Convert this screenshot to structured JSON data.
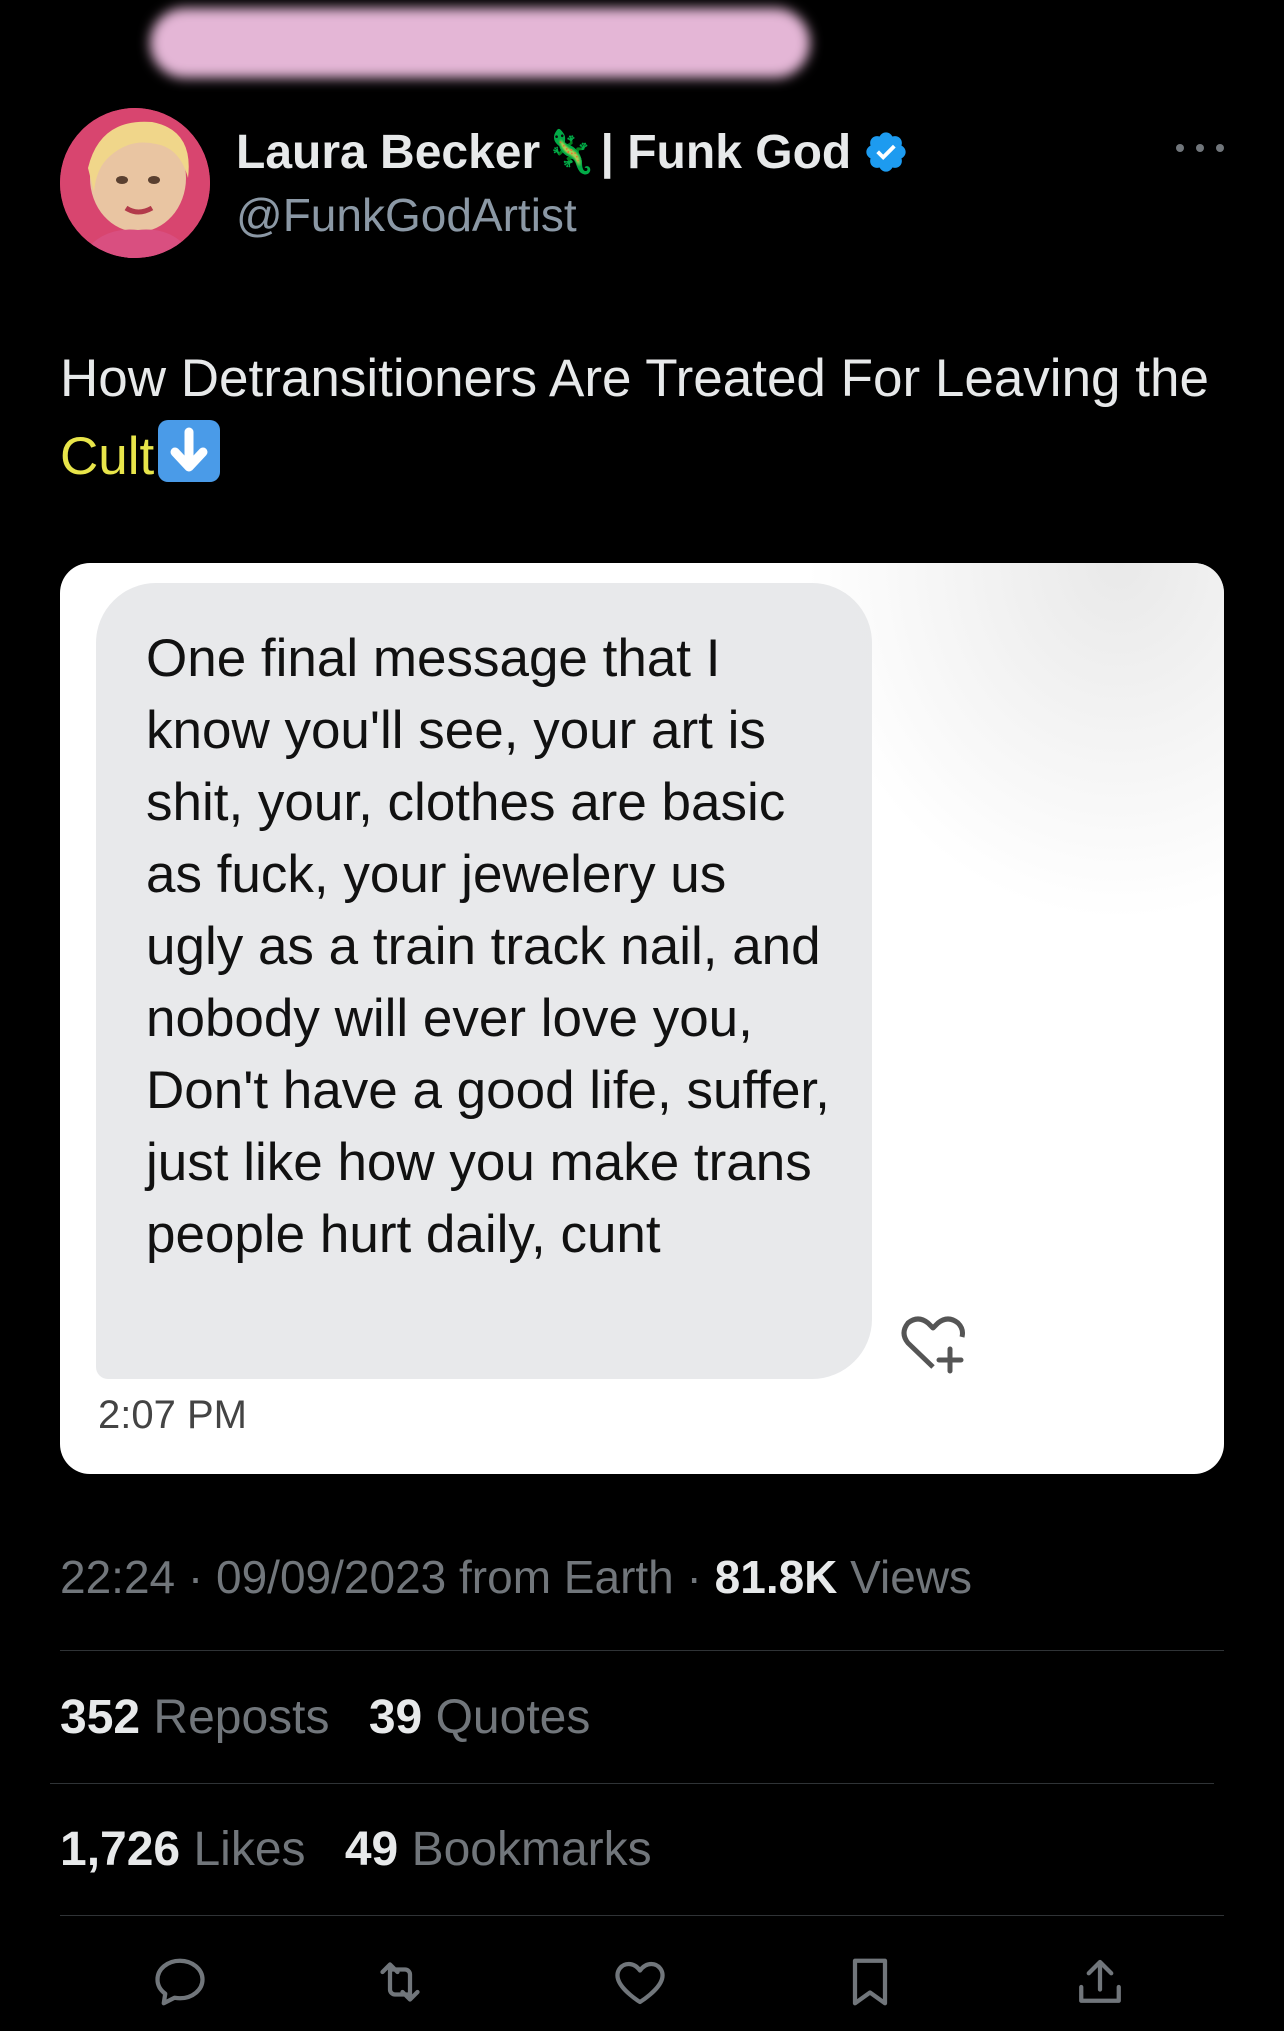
{
  "header": {
    "display_name_first": "Laura Becker",
    "lizard_emoji": "🦎",
    "display_name_second": "| Funk God",
    "handle": "@FunkGodArtist",
    "verified_color": "#1d9bf0"
  },
  "tweet": {
    "text_before": "How Detransitioners Are Treated For Leaving the ",
    "highlight": "Cult",
    "highlight_color": "#e8e54a",
    "emoji_icon": "down-arrow-emoji-icon"
  },
  "media": {
    "message_text": "One final message that I know you'll see, your art is shit, your, clothes are basic as fuck, your jewelery us ugly as a train track nail, and nobody will ever love you, Don't have a good life, suffer, just like how you make trans people hurt daily, cunt",
    "message_time": "2:07 PM",
    "react_icon": "heart-plus-icon"
  },
  "meta": {
    "time": "22:24",
    "sep1": " · ",
    "date": "09/09/2023",
    "source": " from Earth",
    "sep2": " · ",
    "views_count": "81.8K",
    "views_label": " Views"
  },
  "stats": {
    "reposts_count": "352",
    "reposts_label": " Reposts",
    "quotes_count": "39",
    "quotes_label": " Quotes",
    "likes_count": "1,726",
    "likes_label": " Likes",
    "bookmarks_count": "49",
    "bookmarks_label": " Bookmarks"
  },
  "actions": [
    "reply-icon",
    "repost-icon",
    "like-icon",
    "bookmark-icon",
    "share-icon"
  ],
  "colors": {
    "background": "#000000",
    "text": "#e7e9ea",
    "muted": "#71767b",
    "divider": "#2f3336"
  }
}
